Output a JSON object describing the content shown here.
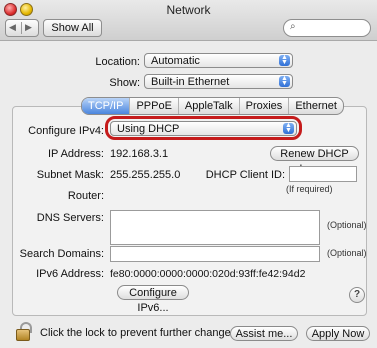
{
  "window": {
    "title": "Network",
    "show_all_label": "Show All",
    "nav_back_icon": "◀",
    "nav_forward_icon": "▶",
    "search_placeholder": ""
  },
  "top": {
    "location_label": "Location:",
    "location_value": "Automatic",
    "show_label": "Show:",
    "show_value": "Built-in Ethernet"
  },
  "tabs": [
    {
      "label": "TCP/IP"
    },
    {
      "label": "PPPoE"
    },
    {
      "label": "AppleTalk"
    },
    {
      "label": "Proxies"
    },
    {
      "label": "Ethernet"
    }
  ],
  "tcpip": {
    "configure_label": "Configure IPv4:",
    "configure_value": "Using DHCP",
    "ip_label": "IP Address:",
    "ip_value": "192.168.3.1",
    "renew_button": "Renew DHCP Lease",
    "subnet_label": "Subnet Mask:",
    "subnet_value": "255.255.255.0",
    "dhcp_client_label": "DHCP Client ID:",
    "dhcp_client_value": "",
    "if_required": "(If required)",
    "router_label": "Router:",
    "router_value": "",
    "dns_label": "DNS Servers:",
    "dns_value": "",
    "dns_optional": "(Optional)",
    "search_domains_label": "Search Domains:",
    "search_domains_value": "",
    "search_optional": "(Optional)",
    "ipv6_label": "IPv6 Address:",
    "ipv6_value": "fe80:0000:0000:0000:020d:93ff:fe42:94d2",
    "configure_ipv6_button": "Configure IPv6..."
  },
  "bottom": {
    "lock_text": "Click the lock to prevent further changes.",
    "assist_button": "Assist me...",
    "apply_button": "Apply Now"
  },
  "colors": {
    "highlight": "#c51b1b",
    "accent": "#4b86de"
  }
}
